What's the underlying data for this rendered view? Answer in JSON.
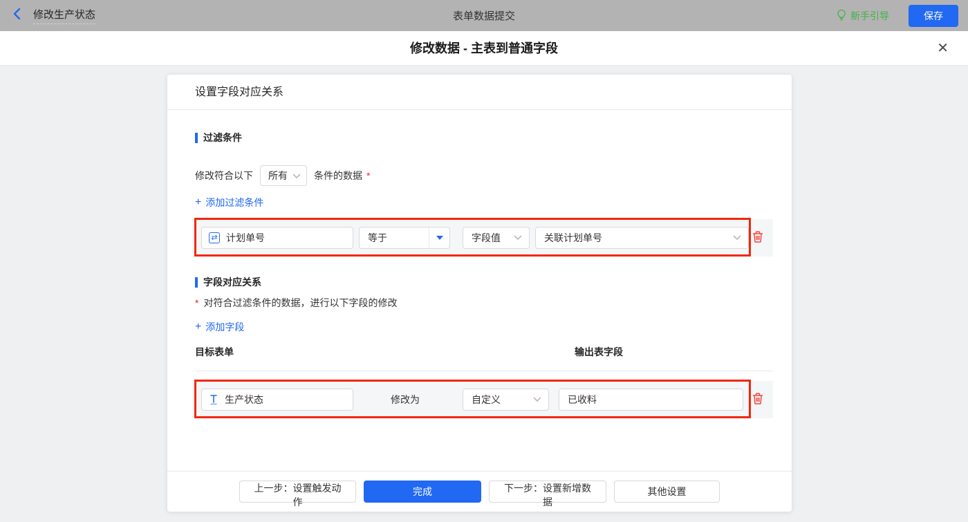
{
  "topbar": {
    "back_title": "修改生产状态",
    "center_title": "表单数据提交",
    "guide_label": "新手引导",
    "save_label": "保存"
  },
  "dialog_title": "修改数据 - 主表到普通字段",
  "icons": {
    "plus": "+",
    "close": "✕",
    "swap": "⇄",
    "required_mark": "*"
  },
  "panel": {
    "header": "设置字段对应关系",
    "filter": {
      "title": "过滤条件",
      "match_prefix": "修改符合以下",
      "match_value": "所有",
      "match_suffix": "条件的数据",
      "add_link": "添加过滤条件",
      "row": {
        "field": "计划单号",
        "operator": "等于",
        "value_type": "字段值",
        "value_field": "关联计划单号"
      }
    },
    "mapping": {
      "title": "字段对应关系",
      "description": "对符合过滤条件的数据，进行以下字段的修改",
      "add_link": "添加字段",
      "col_target": "目标表单",
      "col_output": "输出表字段",
      "row": {
        "field": "生产状态",
        "modify_label": "修改为",
        "mode": "自定义",
        "value": "已收料"
      }
    }
  },
  "footer": {
    "prev": "上一步：设置触发动作",
    "done": "完成",
    "next": "下一步：设置新增数据",
    "other": "其他设置"
  },
  "colors": {
    "accent_blue": "#2168f2",
    "guide_green": "#3eb343",
    "annotation_red": "#f2270c",
    "delete_red": "#f5453d",
    "topbar_gray": "#b3b3b3",
    "page_bg": "#eef0f2",
    "row_bg": "#f5f6f7"
  }
}
